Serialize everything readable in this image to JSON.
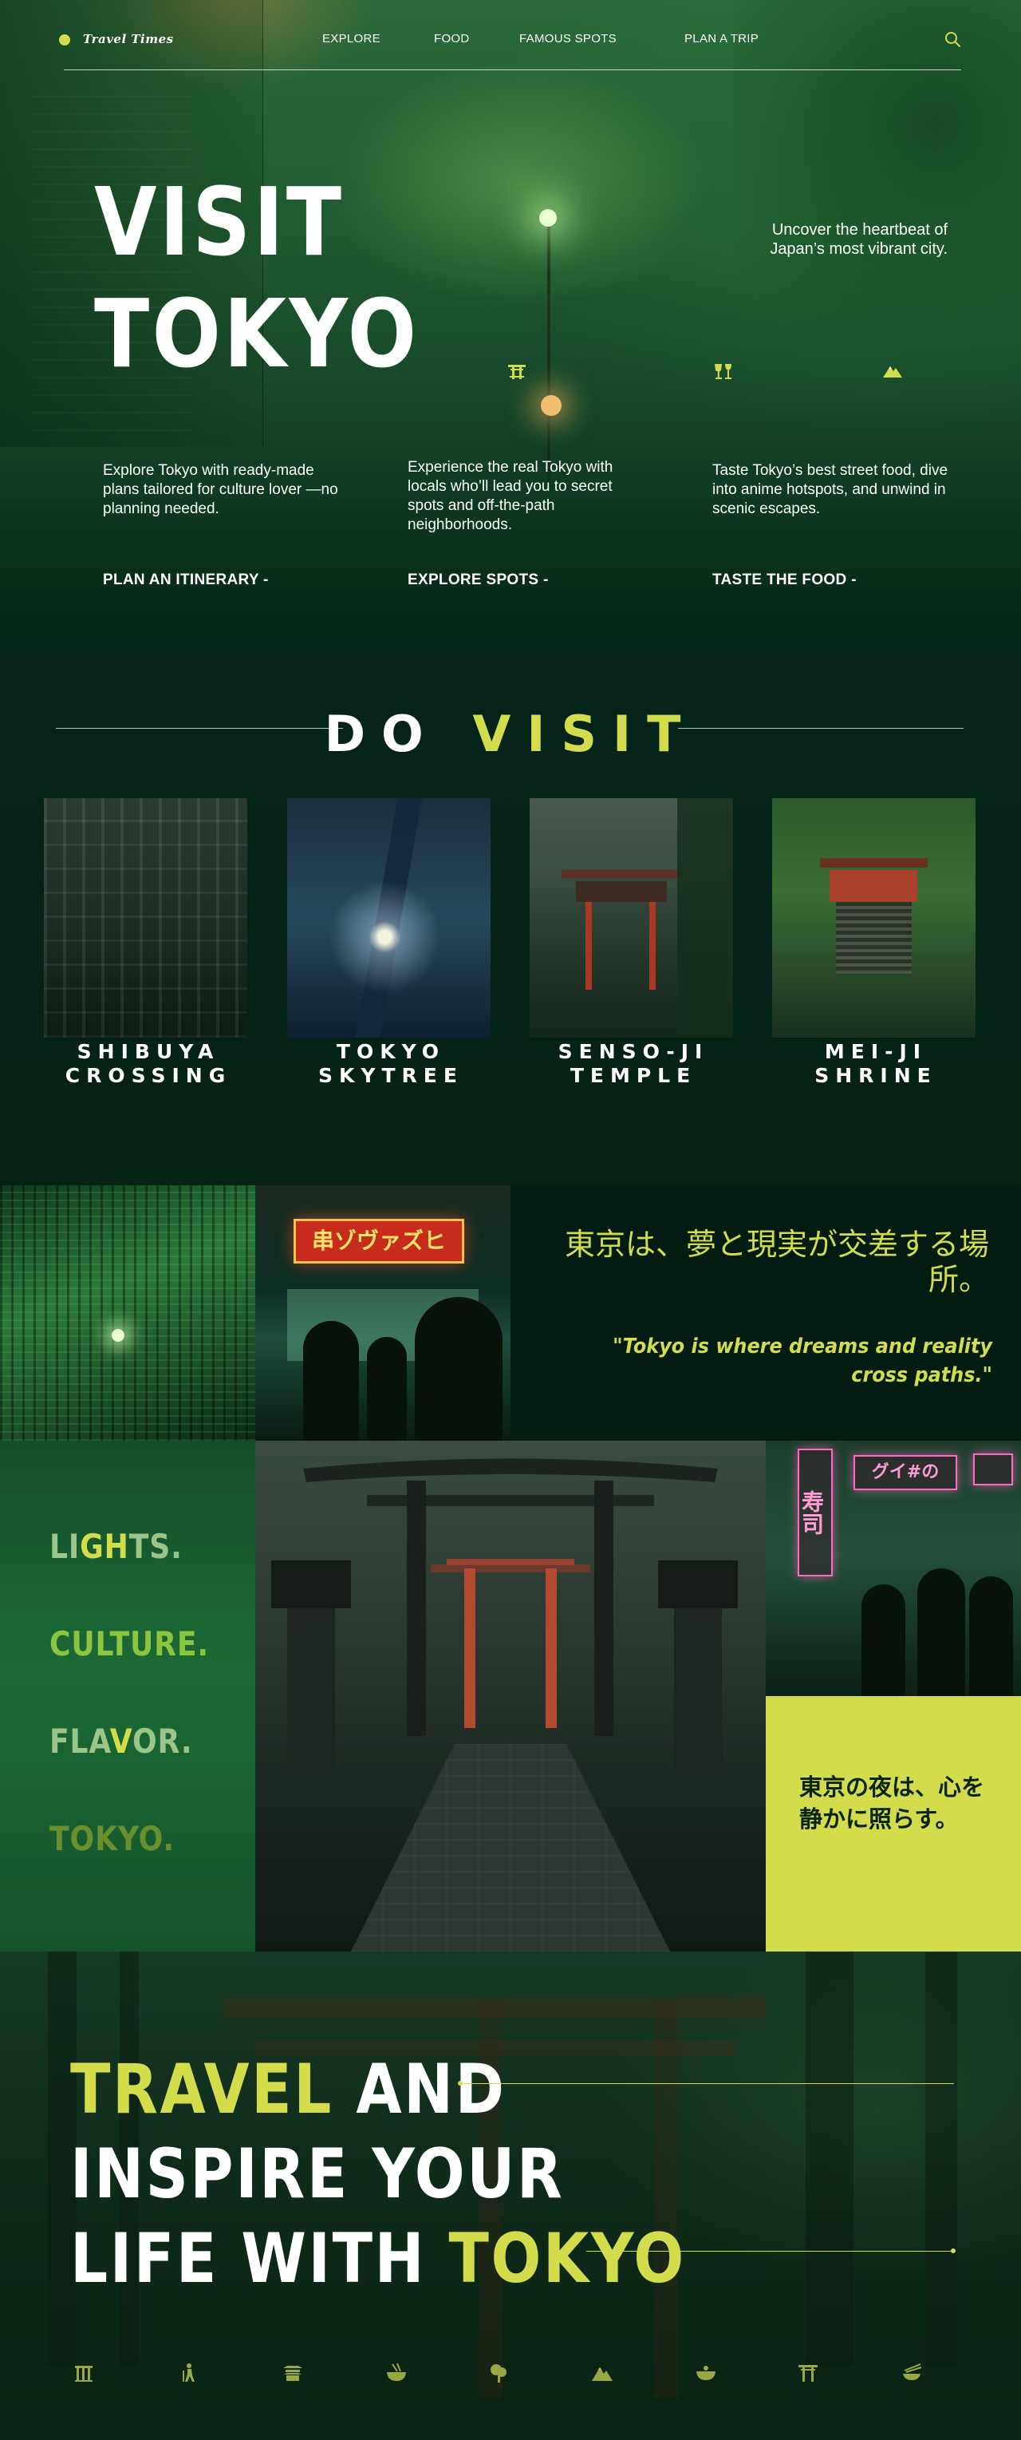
{
  "brand": {
    "name": "Travel Times",
    "accent": "#d3dc4b",
    "bg": "#031a0e"
  },
  "nav": {
    "links": [
      "EXPLORE",
      "FOOD",
      "FAMOUS SPOTS",
      "PLAN A TRIP"
    ],
    "search_icon": "search-icon"
  },
  "hero": {
    "title_line1": "VISIT",
    "title_line2": "TOKYO",
    "tagline": "Uncover the heartbeat of Japan’s most vibrant city.",
    "features": [
      {
        "icon": "torii-icon",
        "text": "Explore Tokyo with ready-made plans tailored for culture lover —no planning needed.",
        "link": "PLAN AN ITINERARY -"
      },
      {
        "icon": "drinks-icon",
        "text": "Experience the real Tokyo with locals who’ll lead you to secret spots and off-the-path neighborhoods.",
        "link": "EXPLORE SPOTS -"
      },
      {
        "icon": "mountain-icon",
        "text": "Taste Tokyo’s best street food, dive into anime hotspots, and unwind in scenic escapes.",
        "link": "TASTE THE FOOD -"
      }
    ]
  },
  "do_visit": {
    "title_do": "DO",
    "title_visit": "VISIT",
    "cards": [
      {
        "line1": "SHIBUYA",
        "line2": "CROSSING"
      },
      {
        "line1": "TOKYO",
        "line2": "SKYTREE"
      },
      {
        "line1": "SENSO-JI",
        "line2": "TEMPLE"
      },
      {
        "line1": "MEI-JI",
        "line2": "SHRINE"
      }
    ]
  },
  "quote": {
    "shop_sign": "串ゾヴァズヒ",
    "japanese": "東京は、夢と現実が交差する場所。",
    "english": "\"Tokyo is where dreams and reality cross paths.\""
  },
  "mosaic": {
    "words": [
      {
        "text": "LIGHTS.",
        "parts": [
          "LI",
          "GH",
          "TS."
        ]
      },
      {
        "text": "CULTURE.",
        "parts": [
          "",
          "CULTURE.",
          ""
        ]
      },
      {
        "text": "FLAVOR.",
        "parts": [
          "FLA",
          "V",
          "OR."
        ]
      },
      {
        "text": "TOKYO.",
        "parts": [
          "",
          "TOKYO.",
          ""
        ]
      }
    ],
    "neon_signs": [
      "寿司",
      "グイ#の"
    ],
    "night_quote": "東京の夜は、心を静かに照らす。"
  },
  "inspire": {
    "w1": "TRAVEL",
    "w2": " AND",
    "line2": "INSPIRE YOUR",
    "w3": "LIFE WITH ",
    "w4": "TOKYO"
  },
  "footer_icons": [
    "building-icon",
    "hiker-icon",
    "temple-icon",
    "ramen-icon",
    "tree-icon",
    "mountain-icon",
    "bowl-icon",
    "torii-icon",
    "noodles-icon"
  ]
}
